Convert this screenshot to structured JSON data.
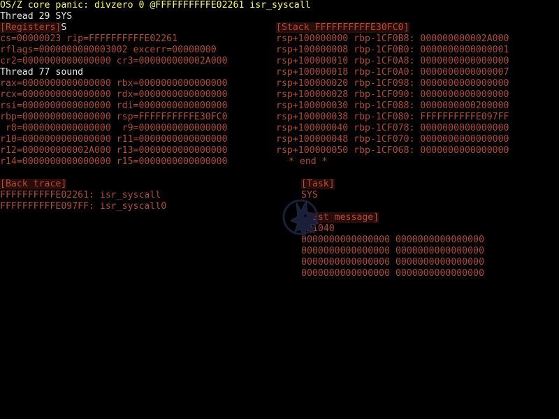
{
  "panic": {
    "title": "OS/Z core panic: divzero 0 @FFFFFFFFFFE02261 isr_syscall",
    "thread_line": "Thread 29 SYS"
  },
  "registers": {
    "header": "[Registers]",
    "cursor_char": "S",
    "lines": [
      "cs=00000023 rip=FFFFFFFFFFE02261",
      "rflags=0000000000003002 excerr=00000000",
      "cr2=0000000000000000 cr3=000000000002A000"
    ],
    "thread2_line": "Thread 77 sound",
    "gp_lines": [
      "rax=0000000000000000 rbx=0000000000000000",
      "rcx=0000000000000000 rdx=0000000000000000",
      "rsi=0000000000000000 rdi=0000000000000000",
      "rbp=0000000000000000 rsp=FFFFFFFFFFE30FC0",
      " r8=0000000000000000  r9=0000000000000000",
      "r10=0000000000000000 r11=0000000000000000",
      "r12=000000000002A000 r13=0000000000000000",
      "r14=0000000000000000 r15=0000000000000000"
    ]
  },
  "stack": {
    "header": "[Stack FFFFFFFFFFE30FC0]",
    "lines": [
      "rsp+100000000 rbp-1CF0B8: 000000000002A000",
      "rsp+100000008 rbp-1CF0B0: 0000000000000001",
      "rsp+100000010 rbp-1CF0A8: 0000000000000000",
      "rsp+100000018 rbp-1CF0A0: 0000000000000007",
      "rsp+100000020 rbp-1CF098: 0000000000000000",
      "rsp+100000028 rbp-1CF090: 0000000000000000",
      "rsp+100000030 rbp-1CF088: 0000000000200000",
      "rsp+100000038 rbp-1CF080: FFFFFFFFFFE097FF",
      "rsp+100000040 rbp-1CF078: 0000000000000000",
      "rsp+100000048 rbp-1CF070: 0000000000000000",
      "rsp+100000050 rbp-1CF068: 0000000000000000"
    ],
    "end_marker": "* end *"
  },
  "backtrace": {
    "header": "[Back trace]",
    "lines": [
      "FFFFFFFFFFE02261: isr_syscall",
      "FFFFFFFFFFE097FF: isr_syscall0"
    ]
  },
  "task": {
    "header": "[Task]",
    "name": "SYS"
  },
  "last_message": {
    "header": "[Last message]",
    "address": "@1040",
    "lines": [
      "0000000000000000 0000000000000000",
      "0000000000000000 0000000000000000",
      "0000000000000000 0000000000000000",
      "0000000000000000 0000000000000000"
    ]
  },
  "logo": {
    "icon": "wolf-head-logo-icon",
    "color": "#1c1f3a"
  },
  "colors": {
    "background": "#000000",
    "title": "#ffff55",
    "thread": "#e8e8e8",
    "data": "#b24a3a",
    "header_bg": "#2a0c08"
  }
}
